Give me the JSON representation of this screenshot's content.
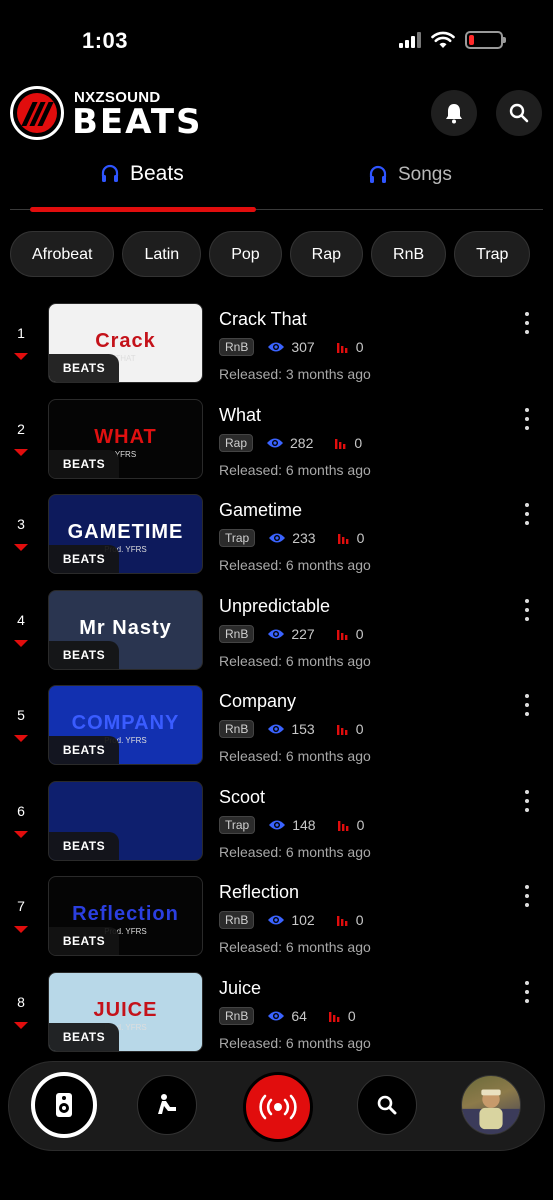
{
  "status_bar": {
    "time": "1:03",
    "battery_level": 0.15
  },
  "brand": {
    "name_top": "NXZSOUND",
    "name_main": "BEATS",
    "accent": "#e10d0d"
  },
  "tabs": [
    {
      "label": "Beats",
      "active": true
    },
    {
      "label": "Songs",
      "active": false
    }
  ],
  "genres": [
    "Afrobeat",
    "Latin",
    "Pop",
    "Rap",
    "RnB",
    "Trap"
  ],
  "thumb_badge": "BEATS",
  "beats": [
    {
      "rank": "1",
      "title": "Crack That",
      "genre": "RnB",
      "views": "307",
      "plays": "0",
      "released": "Released: 3 months ago",
      "cover_text": "Crack",
      "cover_sub": "THAT",
      "cover_bg": "#f2f2f2",
      "cover_color": "#c4121a"
    },
    {
      "rank": "2",
      "title": "What",
      "genre": "Rap",
      "views": "282",
      "plays": "0",
      "released": "Released: 6 months ago",
      "cover_text": "WHAT",
      "cover_sub": "YFRS",
      "cover_bg": "#050505",
      "cover_color": "#e01010"
    },
    {
      "rank": "3",
      "title": "Gametime",
      "genre": "Trap",
      "views": "233",
      "plays": "0",
      "released": "Released: 6 months ago",
      "cover_text": "GAMETIME",
      "cover_sub": "Prod. YFRS",
      "cover_bg": "#0d1a5c",
      "cover_color": "#ffffff"
    },
    {
      "rank": "4",
      "title": "Unpredictable",
      "genre": "RnB",
      "views": "227",
      "plays": "0",
      "released": "Released: 6 months ago",
      "cover_text": "Mr Nasty",
      "cover_sub": "",
      "cover_bg": "#2a3550",
      "cover_color": "#ffffff"
    },
    {
      "rank": "5",
      "title": "Company",
      "genre": "RnB",
      "views": "153",
      "plays": "0",
      "released": "Released: 6 months ago",
      "cover_text": "COMPANY",
      "cover_sub": "Prod. YFRS",
      "cover_bg": "#1230b0",
      "cover_color": "#3a5cff"
    },
    {
      "rank": "6",
      "title": "Scoot",
      "genre": "Trap",
      "views": "148",
      "plays": "0",
      "released": "Released: 6 months ago",
      "cover_text": "",
      "cover_sub": "",
      "cover_bg": "#0e1f6e",
      "cover_color": "#ffffff"
    },
    {
      "rank": "7",
      "title": "Reflection",
      "genre": "RnB",
      "views": "102",
      "plays": "0",
      "released": "Released: 6 months ago",
      "cover_text": "Reflection",
      "cover_sub": "Prod. YFRS",
      "cover_bg": "#050505",
      "cover_color": "#2b3fe0"
    },
    {
      "rank": "8",
      "title": "Juice",
      "genre": "RnB",
      "views": "64",
      "plays": "0",
      "released": "Released: 6 months ago",
      "cover_text": "JUICE",
      "cover_sub": "Prod. YFRS",
      "cover_bg": "#b8d8e8",
      "cover_color": "#c4121a"
    }
  ],
  "colors": {
    "views_icon": "#3a63ff",
    "plays_icon": "#e10d0d",
    "tab_icon": "#2f55ff"
  }
}
